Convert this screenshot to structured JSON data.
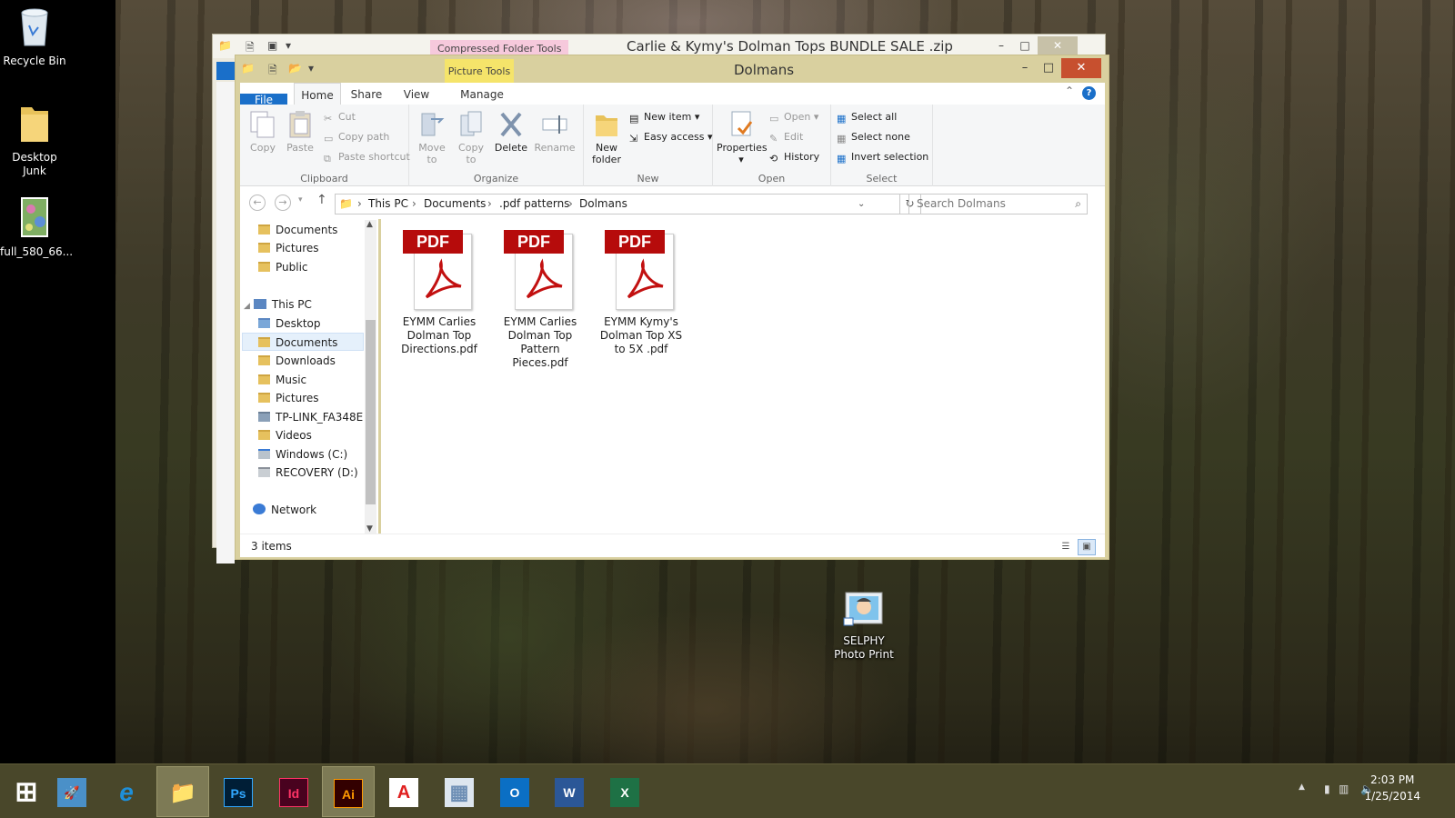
{
  "desktop": {
    "icons": [
      {
        "label": "Recycle Bin"
      },
      {
        "label": "Desktop Junk"
      },
      {
        "label": "full_580_66..."
      },
      {
        "label": "SELPHY Photo Print"
      }
    ]
  },
  "zip_window": {
    "context_tab": "Compressed Folder Tools",
    "title": "Carlie & Kymy's Dolman Tops BUNDLE SALE .zip"
  },
  "explorer": {
    "title": "Dolmans",
    "context_tab": "Picture Tools",
    "tabs": [
      "File",
      "Home",
      "Share",
      "View",
      "Manage"
    ],
    "ribbon": {
      "clipboard": {
        "label": "Clipboard",
        "copy": "Copy",
        "paste": "Paste",
        "cut": "Cut",
        "copy_path": "Copy path",
        "paste_shortcut": "Paste shortcut"
      },
      "organize": {
        "label": "Organize",
        "move_to": "Move to",
        "copy_to": "Copy to",
        "delete": "Delete",
        "rename": "Rename"
      },
      "new": {
        "label": "New",
        "new_folder": "New folder",
        "new_item": "New item",
        "easy_access": "Easy access"
      },
      "open": {
        "label": "Open",
        "properties": "Properties",
        "open": "Open",
        "edit": "Edit",
        "history": "History"
      },
      "select": {
        "label": "Select",
        "select_all": "Select all",
        "select_none": "Select none",
        "invert_selection": "Invert selection"
      }
    },
    "breadcrumb": [
      "This PC",
      "Documents",
      ".pdf patterns",
      "Dolmans"
    ],
    "search_placeholder": "Search Dolmans",
    "nav_items": [
      {
        "label": "Documents",
        "indent": 1
      },
      {
        "label": "Pictures",
        "indent": 1
      },
      {
        "label": "Public",
        "indent": 1
      },
      {
        "label": "This PC",
        "indent": 0
      },
      {
        "label": "Desktop",
        "indent": 1
      },
      {
        "label": "Documents",
        "indent": 1,
        "selected": true
      },
      {
        "label": "Downloads",
        "indent": 1
      },
      {
        "label": "Music",
        "indent": 1
      },
      {
        "label": "Pictures",
        "indent": 1
      },
      {
        "label": "TP-LINK_FA348E",
        "indent": 1
      },
      {
        "label": "Videos",
        "indent": 1
      },
      {
        "label": "Windows (C:)",
        "indent": 1
      },
      {
        "label": "RECOVERY (D:)",
        "indent": 1
      },
      {
        "label": "Network",
        "indent": 0
      }
    ],
    "files": [
      {
        "name": "EYMM Carlies Dolman Top Directions.pdf",
        "badge": "PDF"
      },
      {
        "name": "EYMM Carlies Dolman Top Pattern Pieces.pdf",
        "badge": "PDF"
      },
      {
        "name": "EYMM Kymy's Dolman Top XS to 5X .pdf",
        "badge": "PDF"
      }
    ],
    "status": "3 items"
  },
  "taskbar": {
    "apps": [
      {
        "icon": "start-icon",
        "glyph": "⊞"
      },
      {
        "icon": "rocket-icon",
        "glyph": "🚀"
      },
      {
        "icon": "ie-icon",
        "glyph": "e",
        "color": "#1e8fd8"
      },
      {
        "icon": "file-explorer-icon",
        "glyph": "📁",
        "active": true
      },
      {
        "icon": "photoshop-icon",
        "glyph": "Ps",
        "color": "#31a8ff"
      },
      {
        "icon": "indesign-icon",
        "glyph": "Id",
        "color": "#ff3366"
      },
      {
        "icon": "illustrator-icon",
        "glyph": "Ai",
        "color": "#ff9a00",
        "active": true
      },
      {
        "icon": "acrobat-icon",
        "glyph": "A",
        "color": "#e02020"
      },
      {
        "icon": "calculator-icon",
        "glyph": "▦",
        "color": "#6e8fb5"
      },
      {
        "icon": "outlook-icon",
        "glyph": "O",
        "color": "#0b6fc4"
      },
      {
        "icon": "word-icon",
        "glyph": "W",
        "color": "#2b5797"
      },
      {
        "icon": "excel-icon",
        "glyph": "X",
        "color": "#1e7145"
      }
    ],
    "time": "2:03 PM",
    "date": "1/25/2014"
  }
}
